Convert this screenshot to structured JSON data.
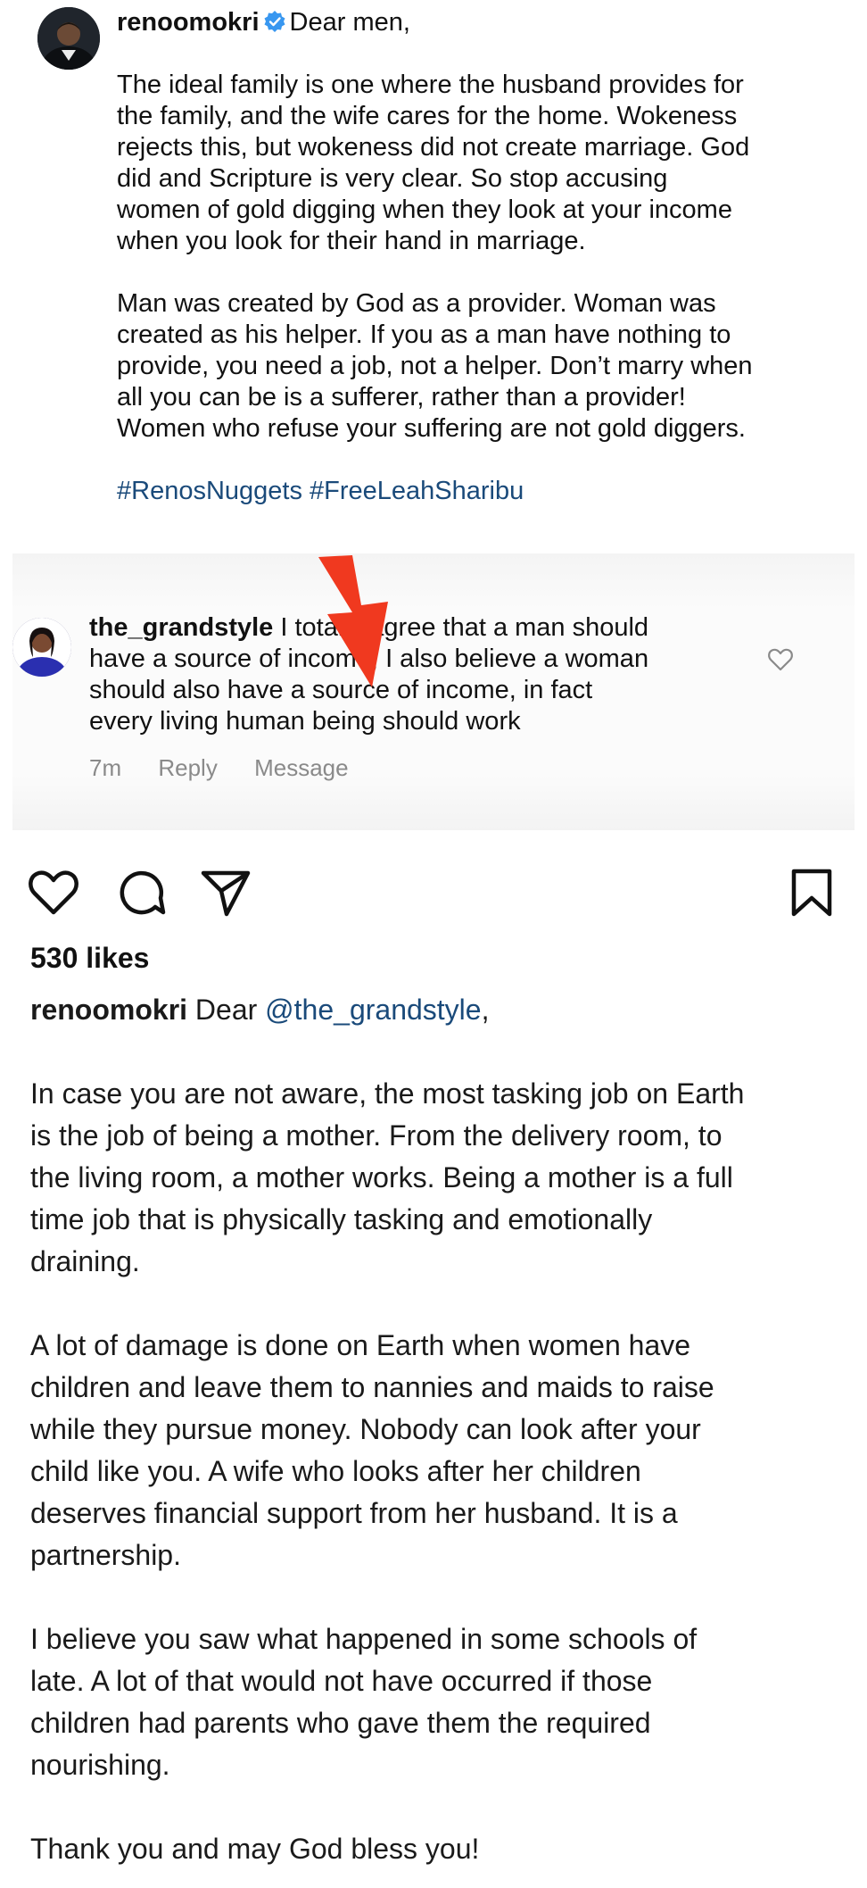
{
  "post": {
    "username": "renoomokri",
    "greeting": "Dear men,",
    "paragraph1": "The ideal family is one where the husband provides for\nthe family, and the wife cares for the home. Wokeness\nrejects this, but wokeness did not create marriage. God\ndid and Scripture is very clear. So stop accusing\nwomen of gold digging when they look at your income\nwhen you look for their hand in marriage.",
    "paragraph2": "Man was created by God as a provider. Woman was\ncreated as his helper. If you as a man have nothing to\nprovide, you need a job, not a helper. Don’t marry when\nall you can be is a sufferer, rather than a provider!\nWomen who refuse your suffering are not gold diggers.",
    "hashtags": "#RenosNuggets #FreeLeahSharibu"
  },
  "comment": {
    "username": "the_grandstyle",
    "text": "I totally agree that a man should\nhave a source of income, I also believe a woman\nshould also have a source of income, in fact\nevery living human being should work",
    "time": "7m",
    "reply_label": "Reply",
    "message_label": "Message"
  },
  "actions": {
    "icons": [
      "heart-icon",
      "comment-icon",
      "share-icon",
      "bookmark-icon"
    ]
  },
  "likes": "530 likes",
  "reply": {
    "username": "renoomokri",
    "dear": "Dear",
    "mention": "@the_grandstyle",
    "comma": ",",
    "paragraph1": "In case you are not aware, the most tasking job on Earth\nis the job of being a mother. From the delivery room, to\nthe living room, a mother works. Being a mother is a full\ntime job that is physically tasking and emotionally\ndraining.",
    "paragraph2": "A lot of damage is done on Earth when women have\nchildren and leave them to nannies and maids to raise\nwhile they pursue money. Nobody can look after your\nchild like you. A wife who looks after her children\ndeserves financial support from her husband. It is a\npartnership.",
    "paragraph3": "I believe you saw what happened in some schools of\nlate. A lot of that would not have occurred if those\nchildren had parents who gave them the required\nnourishing.",
    "paragraph4": "Thank you and may God bless you!"
  },
  "colors": {
    "link": "#1a4a7a",
    "verified": "#3897f0",
    "arrow": "#f0391f",
    "meta": "#8a8a8a"
  }
}
